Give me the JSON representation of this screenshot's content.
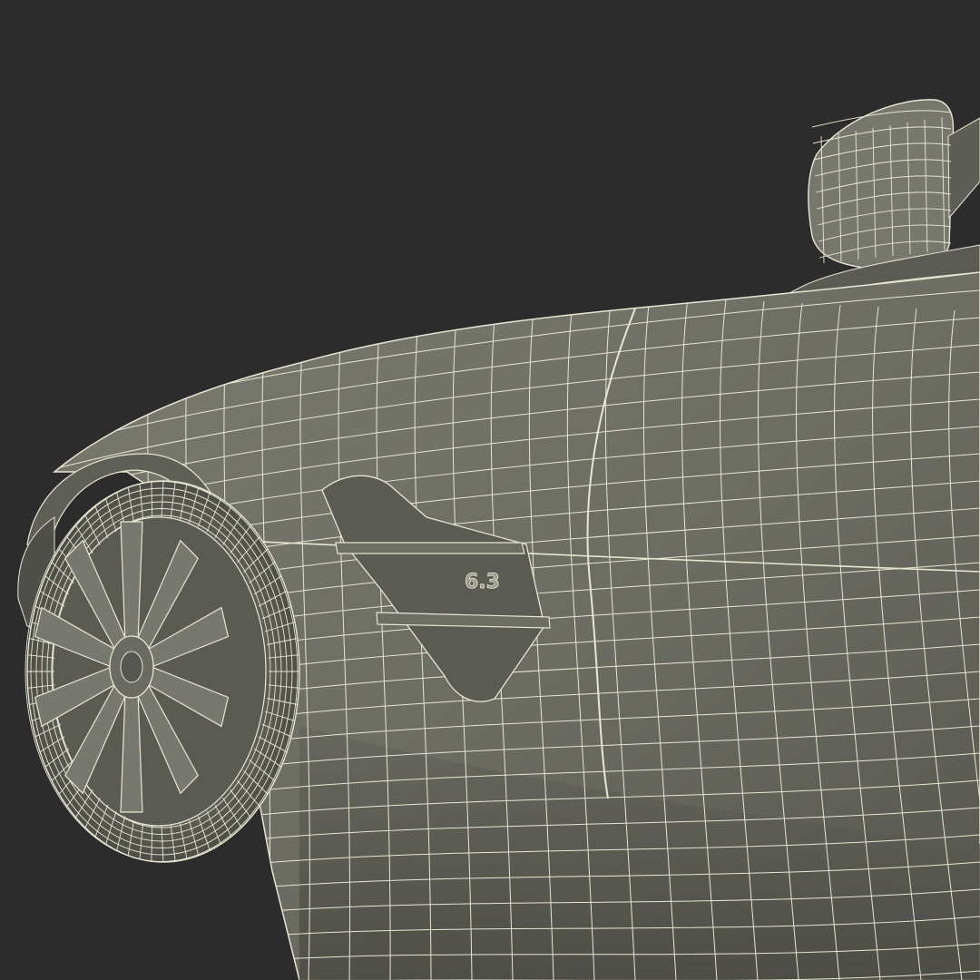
{
  "scene": {
    "background": "#2b2c2b",
    "body_color": "#6f7066",
    "body_shadow": "#4e4f48",
    "body_highlight": "#858679",
    "wire_color": "#e8e6d2",
    "badge": "6.3"
  }
}
